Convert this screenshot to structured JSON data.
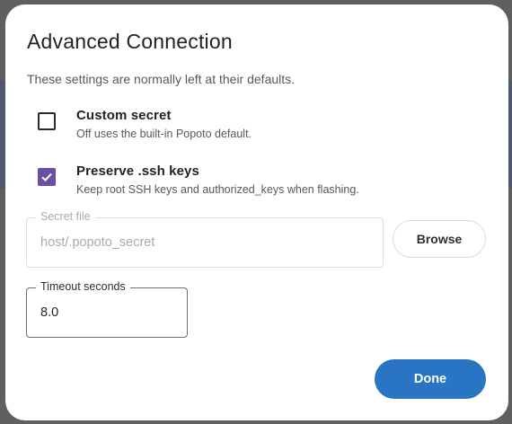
{
  "dialog": {
    "title": "Advanced Connection",
    "subtitle": "These settings are normally left at their defaults."
  },
  "options": [
    {
      "label": "Custom secret",
      "description": "Off uses the built-in Popoto default.",
      "checked": false
    },
    {
      "label": "Preserve .ssh keys",
      "description": "Keep root SSH keys and authorized_keys when flashing.",
      "checked": true
    }
  ],
  "secret_file": {
    "label": "Secret file",
    "value": "host/.popoto_secret",
    "disabled": true
  },
  "browse_button": {
    "label": "Browse"
  },
  "timeout": {
    "label": "Timeout seconds",
    "value": "8.0"
  },
  "done_button": {
    "label": "Done"
  },
  "colors": {
    "accent": "#6a4fa3",
    "primary_button": "#2a74c4"
  }
}
